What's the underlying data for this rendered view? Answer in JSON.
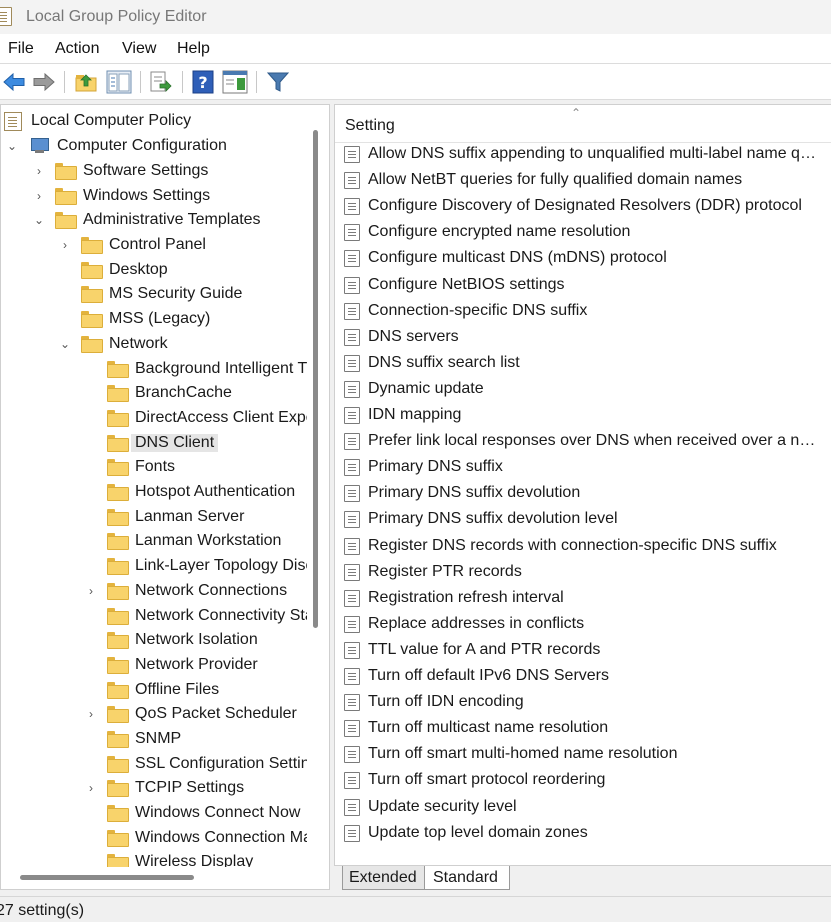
{
  "window": {
    "title": "Local Group Policy Editor"
  },
  "menu": [
    "File",
    "Action",
    "View",
    "Help"
  ],
  "toolbar": {
    "buttons": [
      "back-icon",
      "forward-icon",
      "up-folder-icon",
      "show-hide-tree-icon",
      "export-list-icon",
      "help-icon",
      "properties-pane-icon",
      "filter-icon"
    ]
  },
  "tree": {
    "root": "Local Computer Policy",
    "computer_configuration": "Computer Configuration",
    "software_settings": "Software Settings",
    "windows_settings": "Windows Settings",
    "administrative_templates": "Administrative Templates",
    "control_panel": "Control Panel",
    "desktop": "Desktop",
    "ms_security_guide": "MS Security Guide",
    "mss_legacy": "MSS (Legacy)",
    "network": "Network",
    "network_children": [
      "Background Intelligent Transfer Service (BITS)",
      "BranchCache",
      "DirectAccess Client Experience Settings",
      "DNS Client",
      "Fonts",
      "Hotspot Authentication",
      "Lanman Server",
      "Lanman Workstation",
      "Link-Layer Topology Discovery",
      "Network Connections",
      "Network Connectivity Status Indicator",
      "Network Isolation",
      "Network Provider",
      "Offline Files",
      "QoS Packet Scheduler",
      "SNMP",
      "SSL Configuration Settings",
      "TCPIP Settings",
      "Windows Connect Now",
      "Windows Connection Manager",
      "Wireless Display"
    ]
  },
  "settings": {
    "column": "Setting",
    "items": [
      "Allow DNS suffix appending to unqualified multi-label name queries",
      "Allow NetBT queries for fully qualified domain names",
      "Configure Discovery of Designated Resolvers (DDR) protocol",
      "Configure encrypted name resolution",
      "Configure multicast DNS (mDNS) protocol",
      "Configure NetBIOS settings",
      "Connection-specific DNS suffix",
      "DNS servers",
      "DNS suffix search list",
      "Dynamic update",
      "IDN mapping",
      "Prefer link local responses over DNS when received over a network with higher precedence",
      "Primary DNS suffix",
      "Primary DNS suffix devolution",
      "Primary DNS suffix devolution level",
      "Register DNS records with connection-specific DNS suffix",
      "Register PTR records",
      "Registration refresh interval",
      "Replace addresses in conflicts",
      "TTL value for A and PTR records",
      "Turn off default IPv6 DNS Servers",
      "Turn off IDN encoding",
      "Turn off multicast name resolution",
      "Turn off smart multi-homed name resolution",
      "Turn off smart protocol reordering",
      "Update security level",
      "Update top level domain zones"
    ]
  },
  "tabs": {
    "extended": "Extended",
    "standard": "Standard"
  },
  "status": {
    "text": "27 setting(s)"
  }
}
